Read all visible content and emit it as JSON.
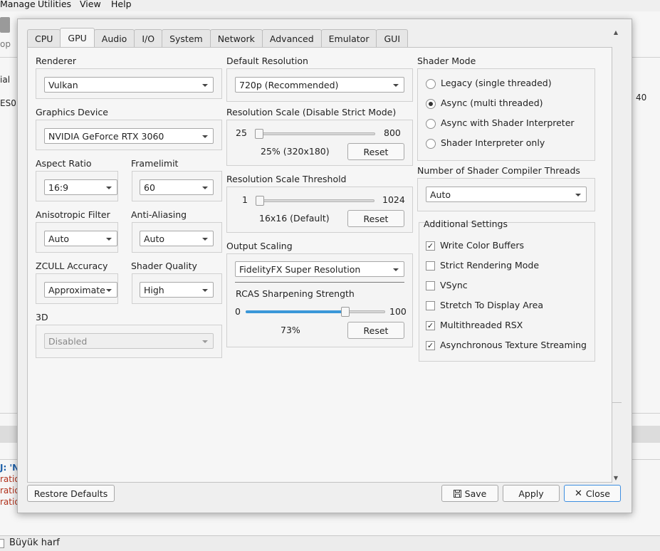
{
  "bg": {
    "menu": [
      "Manage",
      "Utilities",
      "View",
      "Help"
    ],
    "left_frags": [
      "op",
      "ial",
      "ES0",
      "J: 'N",
      "ratio",
      "ratio",
      "ratio"
    ],
    "right_value": "40",
    "status_label": "Büyük harf"
  },
  "tabs": [
    "CPU",
    "GPU",
    "Audio",
    "I/O",
    "System",
    "Network",
    "Advanced",
    "Emulator",
    "GUI"
  ],
  "active_tab": "GPU",
  "col1": {
    "renderer": {
      "label": "Renderer",
      "value": "Vulkan"
    },
    "device": {
      "label": "Graphics Device",
      "value": "NVIDIA GeForce RTX 3060"
    },
    "aspect": {
      "label": "Aspect Ratio",
      "value": "16:9"
    },
    "framelimit": {
      "label": "Framelimit",
      "value": "60"
    },
    "aniso": {
      "label": "Anisotropic Filter",
      "value": "Auto"
    },
    "aa": {
      "label": "Anti-Aliasing",
      "value": "Auto"
    },
    "zcull": {
      "label": "ZCULL Accuracy",
      "value": "Approximate"
    },
    "shader_quality": {
      "label": "Shader Quality",
      "value": "High"
    },
    "threed": {
      "label": "3D",
      "value": "Disabled"
    }
  },
  "col2": {
    "default_res": {
      "label": "Default Resolution",
      "value": "720p (Recommended)"
    },
    "res_scale": {
      "label": "Resolution Scale (Disable Strict Mode)",
      "min": "25",
      "max": "800",
      "value_text": "25% (320x180)",
      "reset": "Reset",
      "fraction": 0.0
    },
    "res_threshold": {
      "label": "Resolution Scale Threshold",
      "min": "1",
      "max": "1024",
      "value_text": "16x16 (Default)",
      "reset": "Reset",
      "fraction": 0.0
    },
    "output_scaling": {
      "label": "Output Scaling",
      "value": "FidelityFX Super Resolution"
    },
    "rcas": {
      "label": "RCAS Sharpening Strength",
      "min": "0",
      "max": "100",
      "value_text": "73%",
      "reset": "Reset",
      "fraction": 0.73
    }
  },
  "col3": {
    "shader_mode": {
      "label": "Shader Mode",
      "options": [
        "Legacy (single threaded)",
        "Async (multi threaded)",
        "Async with Shader Interpreter",
        "Shader Interpreter only"
      ],
      "selected": 1
    },
    "compiler_threads": {
      "label": "Number of Shader Compiler Threads",
      "value": "Auto"
    },
    "additional": {
      "label": "Additional Settings",
      "items": [
        {
          "label": "Write Color Buffers",
          "checked": true
        },
        {
          "label": "Strict Rendering Mode",
          "checked": false
        },
        {
          "label": "VSync",
          "checked": false
        },
        {
          "label": "Stretch To Display Area",
          "checked": false
        },
        {
          "label": "Multithreaded RSX",
          "checked": true
        },
        {
          "label": "Asynchronous Texture Streaming",
          "checked": true
        }
      ]
    }
  },
  "footer": {
    "restore": "Restore Defaults",
    "save": "Save",
    "apply": "Apply",
    "close": "Close"
  },
  "icons": {
    "save": "floppy-disk-icon",
    "close": "x-close-icon"
  }
}
